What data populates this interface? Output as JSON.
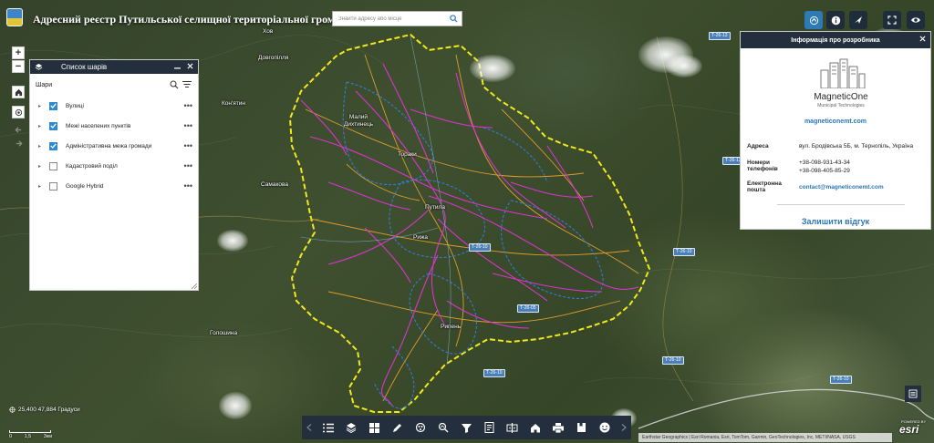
{
  "header": {
    "title": "Адресний реєстр Путильської селищної територіальної громади",
    "search_placeholder": "Знайти адресу або місце",
    "buttons": [
      "locate-widget-icon",
      "info-icon",
      "compass-icon",
      "fullscreen-icon",
      "eye-icon"
    ]
  },
  "map": {
    "places": [
      "Хов",
      "Довгопілля",
      "Кон'ятин",
      "Малий Дихтинець",
      "Тораки",
      "Самакова",
      "Путила",
      "Рижа",
      "Рипень",
      "Голошина"
    ],
    "road_labels": [
      "Т-26-13",
      "Т-26-13",
      "Т-26-10",
      "Т-26-10",
      "Т-26-05",
      "Т-26-10",
      "Т-26-10",
      "Т-26-10"
    ],
    "colors": {
      "boundary": "#f2e81c",
      "streets": "#e233d5",
      "settlements": "#2f7fe0",
      "roads": "#e7a02a"
    }
  },
  "map_controls": {
    "zoom_in": "+",
    "zoom_out": "−"
  },
  "layers_panel": {
    "title": "Список шарів",
    "subtitle": "Шари",
    "layers": [
      {
        "name": "Вулиці",
        "checked": true
      },
      {
        "name": "Межі населених пунктів",
        "checked": true
      },
      {
        "name": "Адміністративна межа громади",
        "checked": true
      },
      {
        "name": "Кадастровий поділ",
        "checked": false
      },
      {
        "name": "Google Hybrid",
        "checked": false
      }
    ],
    "more": "•••"
  },
  "developer_panel": {
    "title": "Інформація про розробника",
    "company": "MagneticOne",
    "company_sub": "Municipal Technologies",
    "website": "magneticonemt.com",
    "address_label": "Адреса",
    "address_value": "вул. Бродівська 5Б, м. Тернопіль, Україна",
    "phones_label": "Номери телефонів",
    "phone_1": "+38-098-931-43-34",
    "phone_2": "+38-098-405-85-29",
    "email_label": "Електронна пошта",
    "email_value": "contact@magneticonemt.com",
    "feedback": "Залишити відгук"
  },
  "footer": {
    "coordinates": "25,400 47,884 Градуси",
    "scale_left": "0",
    "scale_mid": "1,5",
    "scale_right": "3км",
    "attribution": "Earthstar Geographics | Esri Romania, Esri, TomTom, Garmin, GeoTechnologies, Inc, METI/NASA, USGS",
    "esri": "esri",
    "esri_small": "POWERED BY"
  },
  "toolbar": [
    "layers-list-icon",
    "layers-stack-icon",
    "basemap-gallery-icon",
    "draw-icon",
    "analysis-icon",
    "measure-icon",
    "filter-icon",
    "report-icon",
    "swipe-icon",
    "home-icon",
    "print-icon",
    "bookmark-icon",
    "smile-icon"
  ]
}
